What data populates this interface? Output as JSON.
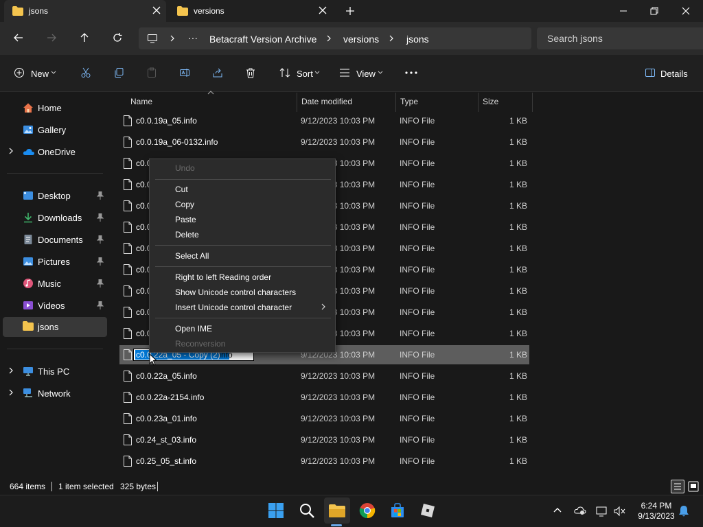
{
  "tabs": [
    {
      "label": "jsons",
      "active": true
    },
    {
      "label": "versions",
      "active": false
    }
  ],
  "address": {
    "breadcrumbs": [
      "Betacraft Version Archive",
      "versions",
      "jsons"
    ],
    "overflow": "···",
    "search_placeholder": "Search jsons"
  },
  "commandbar": {
    "new_label": "New",
    "sort_label": "Sort",
    "view_label": "View",
    "details_label": "Details"
  },
  "sidebar": {
    "quick": [
      {
        "label": "Home",
        "icon": "home-icon"
      },
      {
        "label": "Gallery",
        "icon": "gallery-icon"
      },
      {
        "label": "OneDrive",
        "icon": "onedrive-icon"
      }
    ],
    "pinned": [
      {
        "label": "Desktop",
        "icon": "desktop-icon"
      },
      {
        "label": "Downloads",
        "icon": "downloads-icon"
      },
      {
        "label": "Documents",
        "icon": "documents-icon"
      },
      {
        "label": "Pictures",
        "icon": "pictures-icon"
      },
      {
        "label": "Music",
        "icon": "music-icon"
      },
      {
        "label": "Videos",
        "icon": "videos-icon"
      },
      {
        "label": "jsons",
        "icon": "folder-icon"
      }
    ],
    "devices": [
      {
        "label": "This PC",
        "icon": "this-pc-icon"
      },
      {
        "label": "Network",
        "icon": "network-icon"
      }
    ]
  },
  "columns": {
    "name": "Name",
    "date": "Date modified",
    "type": "Type",
    "size": "Size"
  },
  "files": [
    {
      "name": "c0.0.19a_05.info",
      "date": "9/12/2023 10:03 PM",
      "type": "INFO File",
      "size": "1 KB"
    },
    {
      "name": "c0.0.19a_06-0132.info",
      "date": "9/12/2023 10:03 PM",
      "type": "INFO File",
      "size": "1 KB"
    },
    {
      "name": "c0.0",
      "date": "9/12/2023 10:03 PM",
      "type": "INFO File",
      "size": "1 KB"
    },
    {
      "name": "c0.0",
      "date": "9/12/2023 10:03 PM",
      "type": "INFO File",
      "size": "1 KB"
    },
    {
      "name": "c0.0",
      "date": "9/12/2023 10:03 PM",
      "type": "INFO File",
      "size": "1 KB"
    },
    {
      "name": "c0.0",
      "date": "9/12/2023 10:03 PM",
      "type": "INFO File",
      "size": "1 KB"
    },
    {
      "name": "c0.0",
      "date": "9/12/2023 10:03 PM",
      "type": "INFO File",
      "size": "1 KB"
    },
    {
      "name": "c0.0",
      "date": "9/12/2023 10:03 PM",
      "type": "INFO File",
      "size": "1 KB"
    },
    {
      "name": "c0.0",
      "date": "9/12/2023 10:03 PM",
      "type": "INFO File",
      "size": "1 KB"
    },
    {
      "name": "c0.0",
      "date": "9/12/2023 10:03 PM",
      "type": "INFO File",
      "size": "1 KB"
    },
    {
      "name": "c0.0",
      "date": "9/12/2023 10:03 PM",
      "type": "INFO File",
      "size": "1 KB"
    },
    {
      "name": "",
      "date": "9/12/2023 10:03 PM",
      "type": "INFO File",
      "size": "1 KB"
    },
    {
      "name": "c0.0.22a_05.info",
      "date": "9/12/2023 10:03 PM",
      "type": "INFO File",
      "size": "1 KB"
    },
    {
      "name": "c0.0.22a-2154.info",
      "date": "9/12/2023 10:03 PM",
      "type": "INFO File",
      "size": "1 KB"
    },
    {
      "name": "c0.0.23a_01.info",
      "date": "9/12/2023 10:03 PM",
      "type": "INFO File",
      "size": "1 KB"
    },
    {
      "name": "c0.24_st_03.info",
      "date": "9/12/2023 10:03 PM",
      "type": "INFO File",
      "size": "1 KB"
    },
    {
      "name": "c0.25_05_st.info",
      "date": "9/12/2023 10:03 PM",
      "type": "INFO File",
      "size": "1 KB"
    }
  ],
  "rename": {
    "selected_text": "c0.0.22a_05 - Copy (2)",
    "extension": ".info"
  },
  "context_menu": {
    "undo": "Undo",
    "cut": "Cut",
    "copy": "Copy",
    "paste": "Paste",
    "delete": "Delete",
    "select_all": "Select All",
    "rtl": "Right to left Reading order",
    "show_unicode": "Show Unicode control characters",
    "insert_unicode": "Insert Unicode control character",
    "open_ime": "Open IME",
    "reconversion": "Reconversion"
  },
  "status": {
    "items": "664 items",
    "selected": "1 item selected",
    "size": "325 bytes"
  },
  "clock": {
    "time": "6:24 PM",
    "date": "9/13/2023"
  },
  "colors": {
    "folder": "#f4c44e",
    "accent": "#0078d7",
    "selection": "#5d5d5d"
  }
}
